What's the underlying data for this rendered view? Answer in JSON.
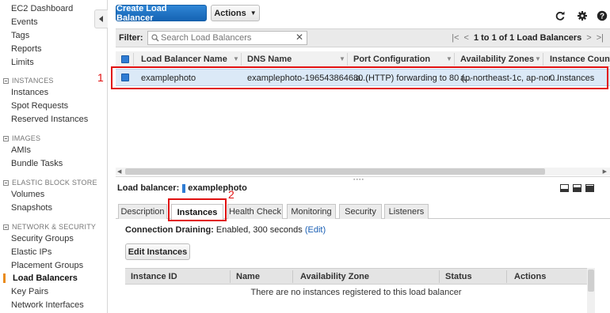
{
  "sidebar": {
    "top_links": [
      {
        "label": "EC2 Dashboard"
      },
      {
        "label": "Events"
      },
      {
        "label": "Tags"
      },
      {
        "label": "Reports"
      },
      {
        "label": "Limits"
      }
    ],
    "sections": [
      {
        "title": "INSTANCES",
        "items": [
          {
            "label": "Instances"
          },
          {
            "label": "Spot Requests"
          },
          {
            "label": "Reserved Instances"
          }
        ]
      },
      {
        "title": "IMAGES",
        "items": [
          {
            "label": "AMIs"
          },
          {
            "label": "Bundle Tasks"
          }
        ]
      },
      {
        "title": "ELASTIC BLOCK STORE",
        "items": [
          {
            "label": "Volumes"
          },
          {
            "label": "Snapshots"
          }
        ]
      },
      {
        "title": "NETWORK & SECURITY",
        "items": [
          {
            "label": "Security Groups"
          },
          {
            "label": "Elastic IPs"
          },
          {
            "label": "Placement Groups"
          },
          {
            "label": "Load Balancers"
          },
          {
            "label": "Key Pairs"
          },
          {
            "label": "Network Interfaces"
          }
        ]
      }
    ],
    "active_item": "Load Balancers"
  },
  "toolbar": {
    "create_label": "Create Load Balancer",
    "actions_label": "Actions",
    "icons": [
      "refresh-icon",
      "gear-icon",
      "help-icon"
    ]
  },
  "filter": {
    "label": "Filter:",
    "placeholder": "Search Load Balancers",
    "pager_text": "1 to 1 of 1 Load Balancers"
  },
  "grid": {
    "columns": [
      "Load Balancer Name",
      "DNS Name",
      "Port Configuration",
      "Availability Zones",
      "Instance Count"
    ],
    "rows": [
      {
        "name": "examplephoto",
        "dns": "examplephoto-1965438646.a...",
        "port": "80 (HTTP) forwarding to 80 (...",
        "zones": "ap-northeast-1c, ap-nor...",
        "count": "0 Instances"
      }
    ]
  },
  "annotations": {
    "one": "1",
    "two": "2"
  },
  "detail": {
    "label": "Load balancer:",
    "name": "examplephoto",
    "tabs": [
      "Description",
      "Instances",
      "Health Check",
      "Monitoring",
      "Security",
      "Listeners"
    ],
    "active_tab": "Instances",
    "draining_label": "Connection Draining:",
    "draining_value": "Enabled, 300 seconds",
    "draining_edit": "(Edit)",
    "edit_button": "Edit Instances",
    "instance_columns": [
      "Instance ID",
      "Name",
      "Availability Zone",
      "Status",
      "Actions"
    ],
    "empty_message": "There are no instances registered to this load balancer"
  },
  "colors": {
    "accent": "#1a73c8",
    "annotation": "#e01010",
    "active_bar": "#e98b1d"
  }
}
